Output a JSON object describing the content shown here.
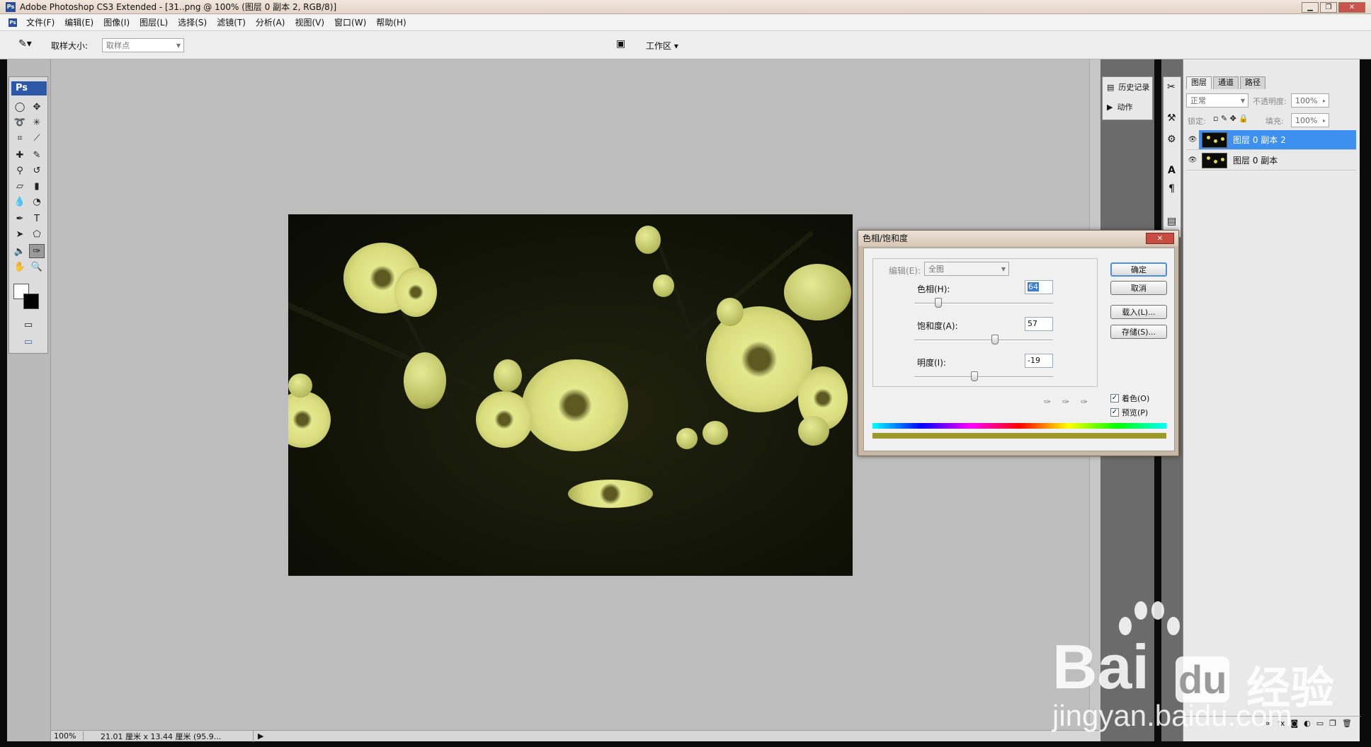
{
  "window": {
    "title": "Adobe Photoshop CS3 Extended - [31..png @ 100% (图层 0 副本 2, RGB/8)]",
    "app_icon": "Ps",
    "controls": [
      "minimize-icon",
      "restore-icon",
      "close-icon"
    ]
  },
  "menu": [
    "文件(F)",
    "编辑(E)",
    "图像(I)",
    "图层(L)",
    "选择(S)",
    "滤镜(T)",
    "分析(A)",
    "视图(V)",
    "窗口(W)",
    "帮助(H)"
  ],
  "options": {
    "sample_label": "取样大小:",
    "sample_value": "取样点",
    "workspace_label": "工作区 ▾"
  },
  "toolbox": {
    "logo": "Ps"
  },
  "panels": {
    "history": "历史记录",
    "actions": "动作"
  },
  "layers_panel": {
    "tabs": [
      "图层",
      "通道",
      "路径"
    ],
    "blend_mode": "正常",
    "opacity_label": "不透明度:",
    "opacity": "100%",
    "lock_label": "锁定:",
    "fill_label": "填充:",
    "fill": "100%",
    "layers": [
      {
        "name": "图层 0 副本 2",
        "selected": true
      },
      {
        "name": "图层 0 副本",
        "selected": false
      }
    ]
  },
  "status": {
    "zoom": "100%",
    "doc_info": "21.01 厘米 x 13.44 厘米 (95.9..."
  },
  "dialog": {
    "title": "色相/饱和度",
    "edit_label": "编辑(E):",
    "edit_value": "全图",
    "hue_label": "色相(H):",
    "hue": "64",
    "saturation_label": "饱和度(A):",
    "saturation": "57",
    "lightness_label": "明度(I):",
    "lightness": "-19",
    "ok": "确定",
    "cancel": "取消",
    "load": "载入(L)...",
    "save": "存储(S)...",
    "colorize": "着色(O)",
    "preview": "预览(P)",
    "colorize_checked": true,
    "preview_checked": true
  },
  "watermark": {
    "brand": "Bai",
    "brand2": "du",
    "cn": "经验",
    "url": "jingyan.baidu.com"
  }
}
